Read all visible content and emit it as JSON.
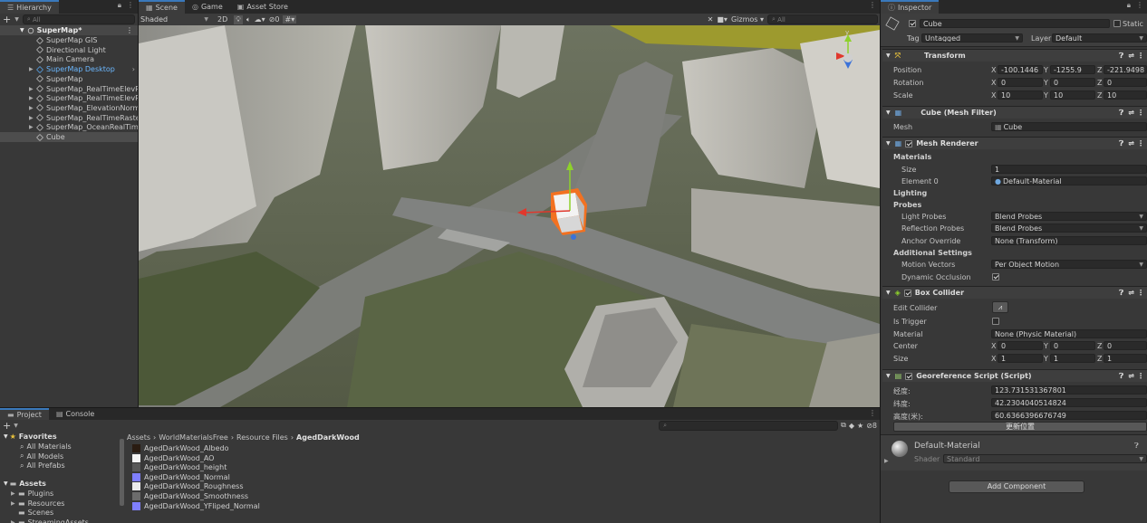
{
  "hierarchy": {
    "tab": "Hierarchy",
    "add": "+",
    "search_placeholder": "All",
    "root": "SuperMap*",
    "items": [
      "SuperMap GIS",
      "Directional Light",
      "Main Camera",
      "SuperMap Desktop",
      "SuperMap",
      "SuperMap_RealTimeElevRa",
      "SuperMap_RealTimeElevRa",
      "SuperMap_ElevationNorma",
      "SuperMap_RealTimeRaster",
      "SuperMap_OceanRealTime",
      "Cube"
    ]
  },
  "scene": {
    "tabs": [
      "Scene",
      "Game",
      "Asset Store"
    ],
    "shading": "Shaded",
    "mode_2d": "2D",
    "hidden_count": "0",
    "gizmos": "Gizmos",
    "search_placeholder": "All"
  },
  "project": {
    "tabs": [
      "Project",
      "Console"
    ],
    "add": "+",
    "hidden_count": "8",
    "favorites": "Favorites",
    "favorite_items": [
      "All Materials",
      "All Models",
      "All Prefabs"
    ],
    "assets": "Assets",
    "asset_folders": [
      "Plugins",
      "Resources",
      "Scenes",
      "StreamingAssets"
    ],
    "breadcrumb": [
      "Assets",
      "WorldMaterialsFree",
      "Resource Files",
      "AgedDarkWood"
    ],
    "files": [
      {
        "name": "AgedDarkWood_Albedo",
        "color": "#2a1c12"
      },
      {
        "name": "AgedDarkWood_AO",
        "color": "#f4f4f4"
      },
      {
        "name": "AgedDarkWood_height",
        "color": "#585858"
      },
      {
        "name": "AgedDarkWood_Normal",
        "color": "#7f7fff"
      },
      {
        "name": "AgedDarkWood_Roughness",
        "color": "#ececec"
      },
      {
        "name": "AgedDarkWood_Smoothness",
        "color": "#6c6c6c"
      },
      {
        "name": "AgedDarkWood_YFliped_Normal",
        "color": "#7f7fff"
      }
    ]
  },
  "inspector": {
    "tab": "Inspector",
    "object_name": "Cube",
    "static_label": "Static",
    "tag_label": "Tag",
    "tag_value": "Untagged",
    "layer_label": "Layer",
    "layer_value": "Default",
    "transform": {
      "title": "Transform",
      "position_label": "Position",
      "position": [
        "-100.1446",
        "-1255.9",
        "-221.9498"
      ],
      "rotation_label": "Rotation",
      "rotation": [
        "0",
        "0",
        "0"
      ],
      "scale_label": "Scale",
      "scale": [
        "10",
        "10",
        "10"
      ]
    },
    "axis_labels": [
      "X",
      "Y",
      "Z"
    ],
    "mesh_filter": {
      "title": "Cube (Mesh Filter)",
      "mesh_label": "Mesh",
      "mesh_value": "Cube"
    },
    "mesh_renderer": {
      "title": "Mesh Renderer",
      "materials": "Materials",
      "size_label": "Size",
      "size_value": "1",
      "element0_label": "Element 0",
      "element0_value": "Default-Material",
      "lighting": "Lighting",
      "probes": "Probes",
      "light_probes_label": "Light Probes",
      "light_probes_value": "Blend Probes",
      "reflection_probes_label": "Reflection Probes",
      "reflection_probes_value": "Blend Probes",
      "anchor_label": "Anchor Override",
      "anchor_value": "None (Transform)",
      "additional": "Additional Settings",
      "motion_label": "Motion Vectors",
      "motion_value": "Per Object Motion",
      "occlusion_label": "Dynamic Occlusion"
    },
    "box_collider": {
      "title": "Box Collider",
      "edit_label": "Edit Collider",
      "trigger_label": "Is Trigger",
      "material_label": "Material",
      "material_value": "None (Physic Material)",
      "center_label": "Center",
      "center": [
        "0",
        "0",
        "0"
      ],
      "size_label": "Size",
      "size": [
        "1",
        "1",
        "1"
      ]
    },
    "georef": {
      "title": "Georeference Script (Script)",
      "lon_label": "经度:",
      "lon_value": "123.731531367801",
      "lat_label": "纬度:",
      "lat_value": "42.2304040514824",
      "alt_label": "高度(米):",
      "alt_value": "60.6366396676749",
      "update_button": "更新位置"
    },
    "material": {
      "name": "Default-Material",
      "shader_label": "Shader",
      "shader_value": "Standard"
    },
    "add_component": "Add Component"
  }
}
